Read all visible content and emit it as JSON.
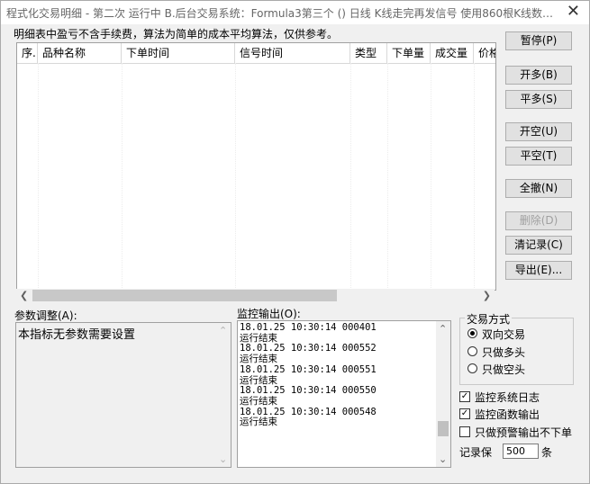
{
  "window": {
    "title": "程式化交易明细 - 第二次 运行中  B.后台交易系统：Formula3第三个 () 日线 K线走完再发信号 使用860根K线数…",
    "close_glyph": "✕"
  },
  "note": "明细表中盈亏不含手续费，算法为简单的成本平均算法，仅供参考。",
  "table": {
    "columns": [
      "序.",
      "品种名称",
      "下单时间",
      "信号时间",
      "类型",
      "下单量",
      "成交量",
      "价格"
    ],
    "rows": []
  },
  "buttons": {
    "pause": "暂停(P)",
    "open_long": "开多(B)",
    "close_long": "平多(S)",
    "open_short": "开空(U)",
    "close_short": "平空(T)",
    "cancel_all": "全撤(N)",
    "delete": "删除(D)",
    "clear_log": "清记录(C)",
    "export": "导出(E)..."
  },
  "params": {
    "label": "参数调整(A):",
    "text": "本指标无参数需要设置"
  },
  "monitor": {
    "label": "监控输出(O):",
    "lines": [
      "18.01.25 10:30:14 000401",
      "运行结束",
      "18.01.25 10:30:14 000552",
      "运行结束",
      "18.01.25 10:30:14 000551",
      "运行结束",
      "18.01.25 10:30:14 000550",
      "运行结束",
      "18.01.25 10:30:14 000548",
      "运行结束"
    ]
  },
  "trade_mode": {
    "title": "交易方式",
    "options": [
      "双向交易",
      "只做多头",
      "只做空头"
    ],
    "selected": "双向交易"
  },
  "checks": {
    "sys_log": {
      "label": "监控系统日志",
      "checked": true
    },
    "func_out": {
      "label": "监控函数输出",
      "checked": true
    },
    "warn_only": {
      "label": "只做预警输出不下单",
      "checked": false
    }
  },
  "record": {
    "label": "记录保",
    "value": "500",
    "unit": "条"
  }
}
